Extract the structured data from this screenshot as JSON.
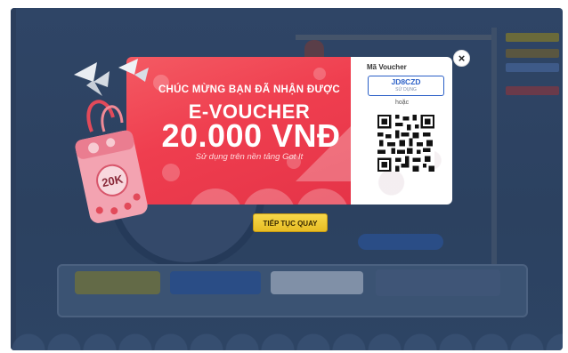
{
  "popup": {
    "heading": "CHÚC MỪNG BẠN ĐÃ NHẬN ĐƯỢC",
    "voucher_type": "E-VOUCHER",
    "amount": "20.000 VNĐ",
    "subtitle": "Sử dụng trên nền tảng Got It",
    "charm_label": "20K",
    "voucher_code_label": "Mã Voucher",
    "voucher_code": "JD8CZD",
    "use_label": "SỬ DỤNG",
    "or_text": "hoặc",
    "close_icon": "×",
    "continue_label": "TIẾP TỤC QUAY"
  },
  "colors": {
    "banner_red": "#ef3e4f",
    "code_blue": "#2a5fc7",
    "button_yellow": "#f2cc3a",
    "overlay": "#2f4566"
  },
  "icons": [
    "close-icon",
    "qr-code-icon",
    "paper-crane-icon",
    "omamori-charm-icon"
  ]
}
